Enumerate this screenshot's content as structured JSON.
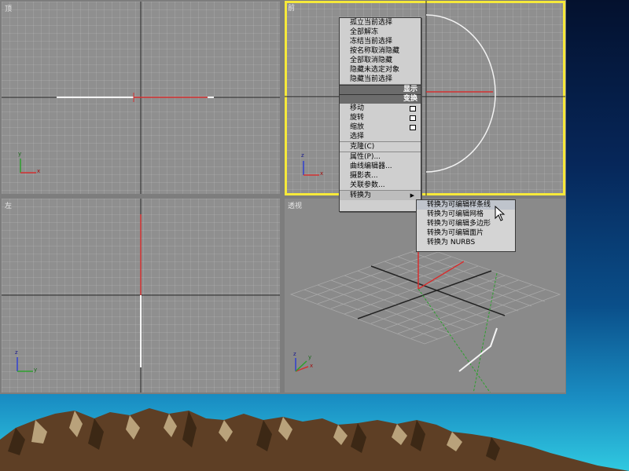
{
  "viewports": {
    "top": {
      "label": "顶"
    },
    "front": {
      "label": "前"
    },
    "left": {
      "label": "左"
    },
    "perspective": {
      "label": "透视"
    }
  },
  "axis_labels": {
    "x": "x",
    "y": "y",
    "z": "z"
  },
  "context_menu": {
    "section1": [
      "孤立当前选择",
      "全部解冻",
      "冻结当前选择",
      "按名称取消隐藏",
      "全部取消隐藏",
      "隐藏未选定对象",
      "隐藏当前选择"
    ],
    "header_display": "显示",
    "header_transform": "变换",
    "transform_items": [
      "移动",
      "旋转",
      "缩放",
      "选择",
      "克隆(C)",
      "属性(P)...",
      "曲线编辑器...",
      "摄影表...",
      "关联参数..."
    ],
    "convert_to": "转换为"
  },
  "submenu": {
    "items": [
      "转换为可编辑样条线",
      "转换为可编辑网格",
      "转换为可编辑多边形",
      "转换为可编辑面片",
      "转换为 NURBS"
    ]
  },
  "colors": {
    "active_border": "#f6e93a",
    "axis_red": "#d43030",
    "axis_green": "#2ca02c",
    "axis_blue": "#2f3fd0",
    "mountain": "#6b4a2e"
  }
}
